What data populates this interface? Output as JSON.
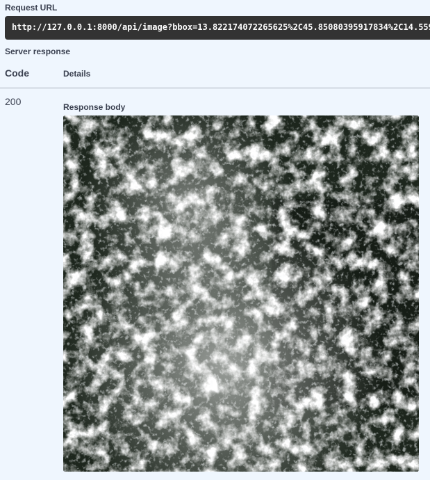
{
  "request": {
    "label": "Request URL",
    "url": "http://127.0.0.1:8000/api/image?bbox=13.822174072265625%2C45.85080395917834%2C14.559"
  },
  "server_response": {
    "label": "Server response",
    "columns": {
      "code": "Code",
      "details": "Details"
    },
    "rows": [
      {
        "code": "200",
        "body_label": "Response body"
      }
    ]
  },
  "image": {
    "description": "satellite-image-response",
    "colors": {
      "land": "#1f2a1f",
      "cloud": "#e8ecef",
      "url_bg": "#333333"
    }
  }
}
